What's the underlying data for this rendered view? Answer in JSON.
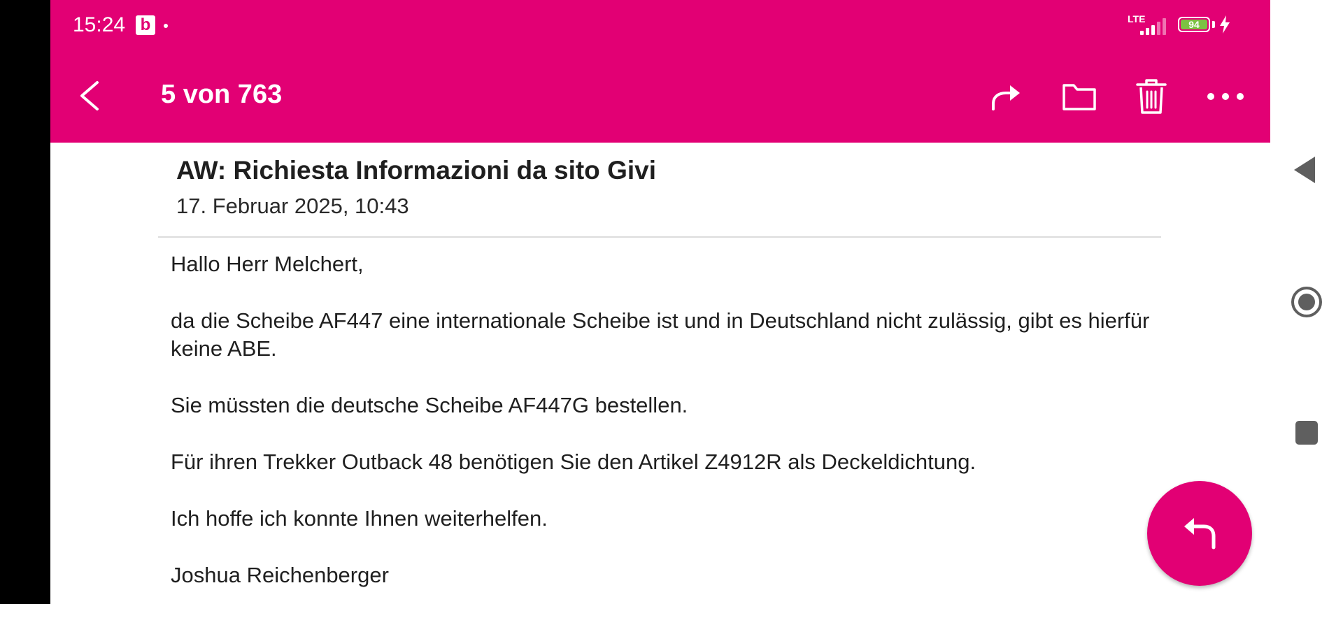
{
  "status_bar": {
    "time": "15:24",
    "app_badge": "b",
    "network": "LTE",
    "battery": "94"
  },
  "toolbar": {
    "title": "5 von 763",
    "icons": [
      "back-icon",
      "forward-icon",
      "folder-icon",
      "trash-icon",
      "more-icon"
    ]
  },
  "email": {
    "subject": "AW: Richiesta Informazioni da sito Givi",
    "date": "17. Februar 2025, 10:43",
    "body": [
      "Hallo Herr Melchert,",
      "da die Scheibe AF447 eine internationale Scheibe ist und in Deutschland nicht zulässig, gibt es hierfür keine ABE.",
      "Sie müssten die deutsche Scheibe AF447G bestellen.",
      "Für ihren Trekker Outback 48 benötigen Sie den Artikel Z4912R als Deckeldichtung.",
      "Ich hoffe ich konnte Ihnen weiterhelfen.",
      "Joshua Reichenberger"
    ]
  },
  "fab": {
    "icon": "reply-icon"
  },
  "system_nav": {
    "icons": [
      "nav-back-icon",
      "nav-home-icon",
      "nav-recents-icon"
    ]
  },
  "colors": {
    "brand": "#e20074",
    "battery_fill": "#7cc242",
    "text": "#1f1f1f"
  }
}
